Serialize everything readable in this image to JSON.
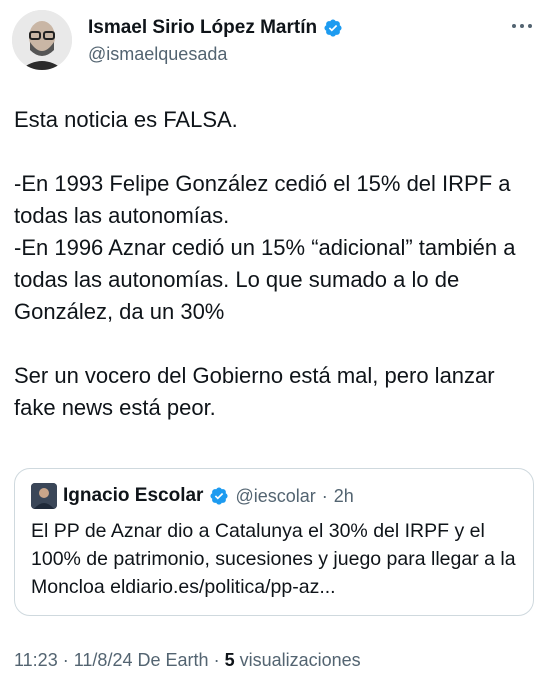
{
  "author": {
    "display_name": "Ismael Sirio López Martín",
    "handle": "@ismaelquesada"
  },
  "tweet": {
    "text": "Esta noticia es FALSA.\n\n-En 1993 Felipe González cedió el 15% del IRPF a todas las autonomías.\n-En 1996 Aznar cedió un 15% “adicional” también a todas las autonomías. Lo que sumado a lo de González, da un 30%\n\nSer un vocero del Gobierno está mal, pero lanzar fake news está peor."
  },
  "quoted": {
    "display_name": "Ignacio Escolar",
    "handle": "@iescolar",
    "separator": "·",
    "time": "2h",
    "text": "El PP de Aznar dio a Catalunya el 30% del IRPF y el 100% de patrimonio, sucesiones y juego para llegar a la Moncloa eldiario.es/politica/pp-az..."
  },
  "meta": {
    "time": "11:23",
    "sep1": "·",
    "date": "11/8/24",
    "source": "De Earth",
    "sep2": "·",
    "views_count": "5",
    "views_label": "visualizaciones"
  },
  "colors": {
    "text": "#0f1419",
    "secondary": "#536471",
    "verified": "#1d9bf0",
    "border": "#cfd9de"
  },
  "icons": {
    "verified": "verified-badge-icon",
    "more": "more-options-icon"
  }
}
